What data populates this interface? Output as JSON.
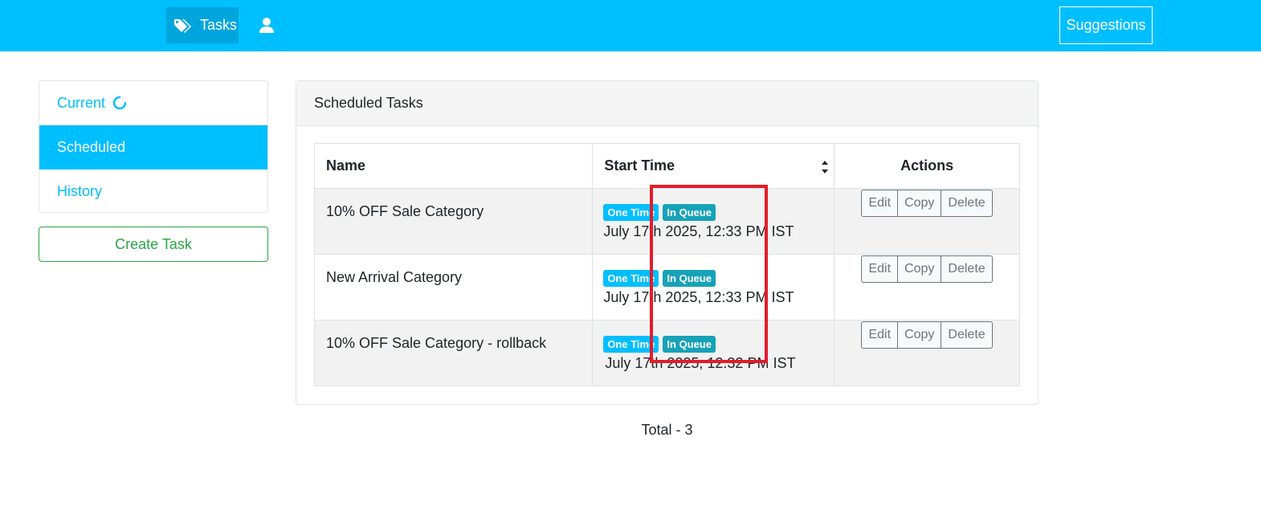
{
  "nav": {
    "tasks_label": "Tasks",
    "tasks_icon": "tags-icon",
    "user_icon": "user-icon",
    "suggestions_label": "Suggestions"
  },
  "sidebar": {
    "items": [
      {
        "label": "Current",
        "icon": "spinner-icon",
        "active": false
      },
      {
        "label": "Scheduled",
        "active": true
      },
      {
        "label": "History",
        "active": false
      }
    ],
    "create_label": "Create Task"
  },
  "card": {
    "title": "Scheduled Tasks",
    "columns": [
      "Name",
      "Start Time",
      "Actions"
    ],
    "rows": [
      {
        "name": "10% OFF Sale Category",
        "type_badge": "One Time",
        "status_badge": "In Queue",
        "start_time": "July 17th 2025, 12:33 PM IST"
      },
      {
        "name": "New Arrival Category",
        "type_badge": "One Time",
        "status_badge": "In Queue",
        "start_time": "July 17th 2025, 12:33 PM IST"
      },
      {
        "name": "10% OFF Sale Category - rollback",
        "type_badge": "One Time",
        "status_badge": "In Queue",
        "start_time": "July 17th 2025, 12:32 PM IST"
      }
    ],
    "actions": [
      "Edit",
      "Copy",
      "Delete"
    ]
  },
  "total_label": "Total - 3",
  "colors": {
    "primary": "#00bfff",
    "success": "#28a745",
    "info": "#17a2b8",
    "highlight": "#e31c2a"
  }
}
